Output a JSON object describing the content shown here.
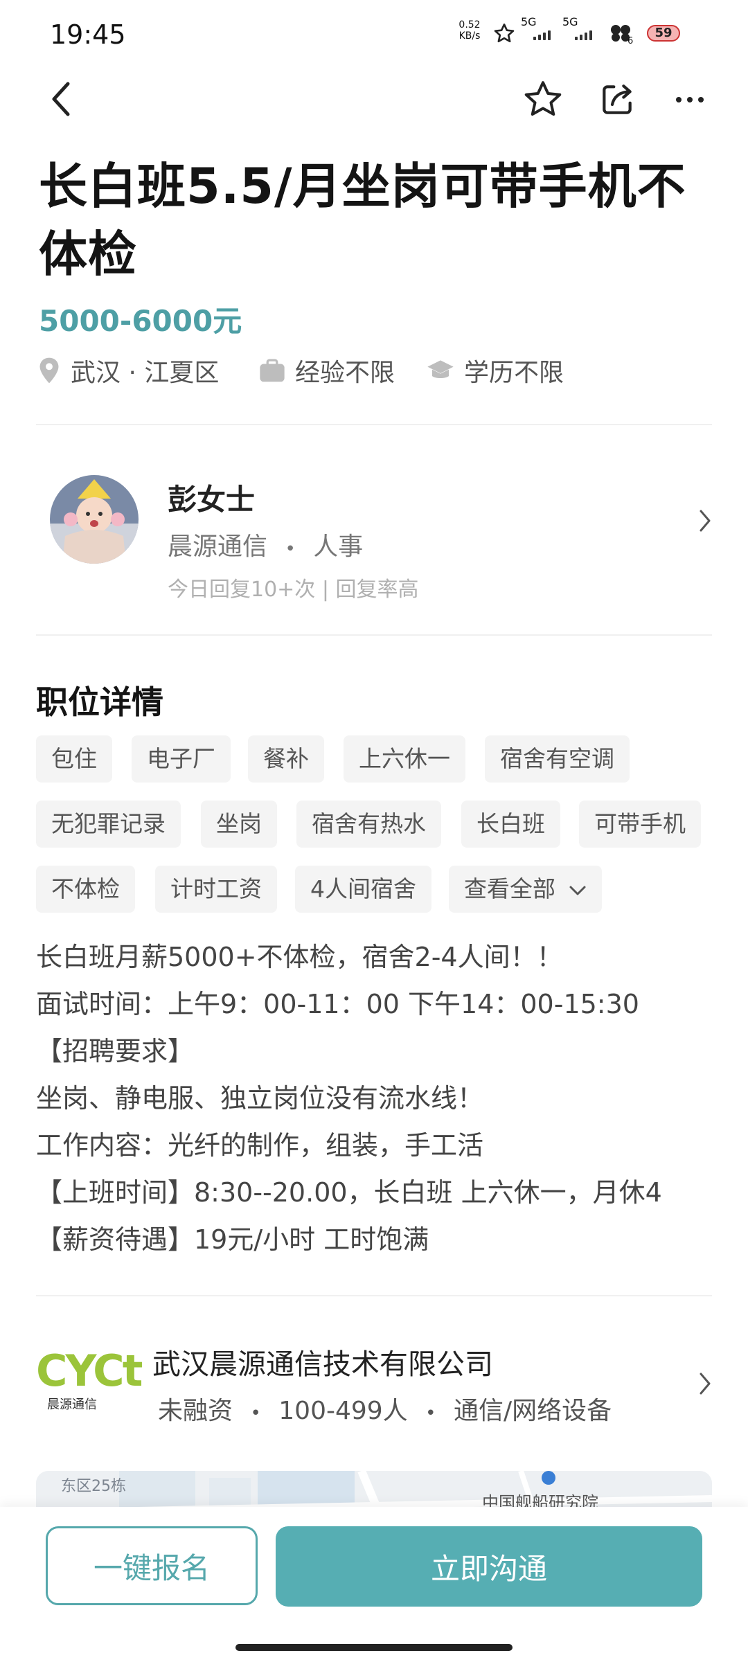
{
  "status_bar": {
    "time": "19:45",
    "net_speed_value": "0.52",
    "net_speed_unit": "KB/s",
    "sim1": "5G",
    "sim2": "5G",
    "wifi_count": "6",
    "battery": "59",
    "icons": [
      "star-icon",
      "signal-icon",
      "signal-icon",
      "wifi-icon",
      "battery-icon"
    ]
  },
  "nav": {
    "icons": [
      "back-icon",
      "favorite-star-icon",
      "share-icon",
      "more-icon"
    ]
  },
  "job": {
    "title": "长白班5.5/月坐岗可带手机不体检",
    "salary": "5000-6000元",
    "location": "武汉 · 江夏区",
    "experience": "经验不限",
    "education": "学历不限"
  },
  "recruiter": {
    "name": "彭女士",
    "company": "晨源通信",
    "separator": "•",
    "role": "人事",
    "reply_stats": "今日回复10+次 | 回复率高"
  },
  "details": {
    "section_title": "职位详情",
    "tags": [
      "包住",
      "电子厂",
      "餐补",
      "上六休一",
      "宿舍有空调",
      "无犯罪记录",
      "坐岗",
      "宿舍有热水",
      "长白班",
      "可带手机",
      "不体检",
      "计时工资",
      "4人间宿舍"
    ],
    "view_all": "查看全部",
    "description": [
      "长白班月薪5000+不体检，宿舍2-4人间！！",
      "面试时间：上午9：00-11：00  下午14：00-15:30",
      "【招聘要求】",
      "坐岗、静电服、独立岗位没有流水线！",
      "工作内容：光纤的制作，组装，手工活",
      "【上班时间】8:30--20.00，长白班 上六休一，月休4",
      "【薪资待遇】19元/小时 工时饱满"
    ]
  },
  "company": {
    "logo_text": "CYCt",
    "logo_sub": "晨源通信",
    "name": "武汉晨源通信技术有限公司",
    "funding": "未融资",
    "size": "100-499人",
    "industry": "通信/网络设备",
    "separator": "•"
  },
  "map": {
    "label_left": "东区25栋",
    "label_right": "中国舰船研究院"
  },
  "actions": {
    "signup": "一键报名",
    "chat": "立即沟通"
  },
  "colors": {
    "accent": "#56aeb3",
    "salary": "#4e9fa5",
    "logo_green": "#9bc43a"
  }
}
